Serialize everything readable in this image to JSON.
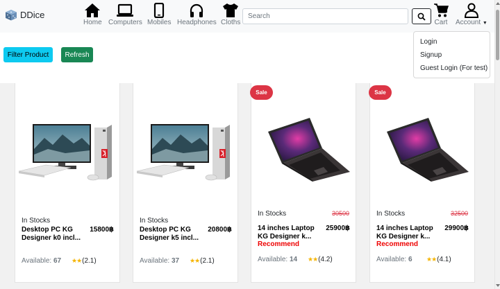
{
  "brand": {
    "name": "DDice"
  },
  "nav": {
    "home": "Home",
    "computers": "Computers",
    "mobiles": "Mobiles",
    "headphones": "Headphones",
    "cloths": "Cloths",
    "cart": "Cart",
    "account": "Account"
  },
  "search": {
    "placeholder": "Search",
    "value": ""
  },
  "account_menu": [
    "Login",
    "Signup",
    "Guest Login (For test)"
  ],
  "toolbar": {
    "filter_label": "Filter Product",
    "refresh_label": "Refresh"
  },
  "products": [
    {
      "type": "computer",
      "sale": "",
      "stock": "In Stocks",
      "old_price": "",
      "name": "Desktop PC KG Designer k0 incl...",
      "price": "15800฿",
      "recommend": "",
      "available_label": "Available:",
      "available": "67",
      "stars": "★★",
      "rating": "(2.1)"
    },
    {
      "type": "computer",
      "sale": "",
      "stock": "In Stocks",
      "old_price": "",
      "name": "Desktop PC KG Designer k5 incl...",
      "price": "20800฿",
      "recommend": "",
      "available_label": "Available:",
      "available": "37",
      "stars": "★★",
      "rating": "(2.1)"
    },
    {
      "type": "laptop",
      "sale": "Sale",
      "stock": "In Stocks",
      "old_price": "30500",
      "name": "14 inches Laptop KG Designer k...",
      "price": "25900฿",
      "recommend": "Recommend",
      "available_label": "Available:",
      "available": "14",
      "stars": "★★",
      "rating": "(4.2)"
    },
    {
      "type": "laptop",
      "sale": "Sale",
      "stock": "In Stocks",
      "old_price": "32500",
      "name": "14 inches Laptop KG Designer k...",
      "price": "29900฿",
      "recommend": "Recommend",
      "available_label": "Available:",
      "available": "6",
      "stars": "★★",
      "rating": "(4.1)"
    }
  ],
  "colors": {
    "info": "#0dcaf0",
    "success": "#198754",
    "danger": "#dc3545",
    "star": "#f5b400"
  }
}
